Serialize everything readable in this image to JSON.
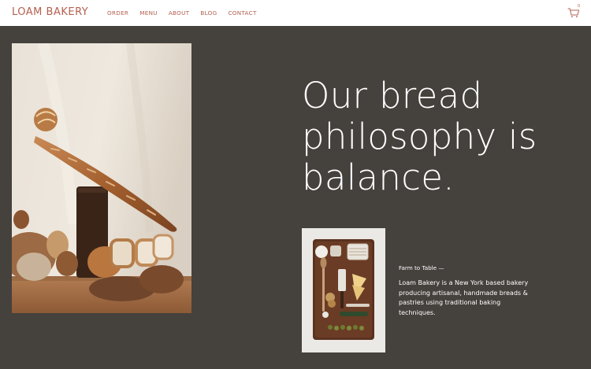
{
  "header": {
    "logo": "LOAM BAKERY",
    "nav": [
      "ORDER",
      "MENU",
      "ABOUT",
      "BLOG",
      "CONTACT"
    ],
    "cart_count": "0"
  },
  "hero": {
    "headline": "Our bread philosophy is balance."
  },
  "about": {
    "kicker": "Farm to Table —",
    "description": "Loam Bakery is a New York based bakery producing artisanal, handmade breads & pastries using traditional baking techniques."
  },
  "colors": {
    "background": "#45413d",
    "brand": "#b4604f",
    "header_bg": "#ffffff"
  },
  "icons": [
    "cart-icon"
  ]
}
